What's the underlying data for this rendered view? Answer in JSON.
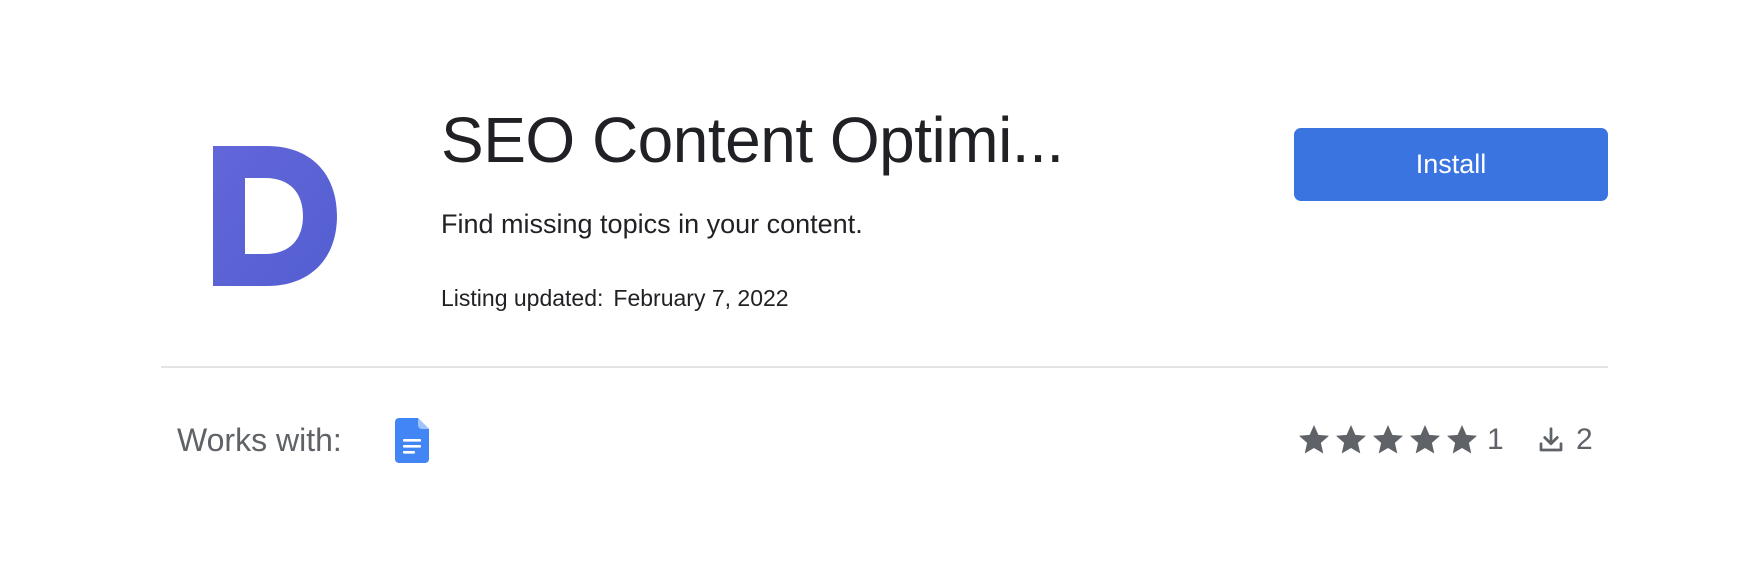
{
  "app": {
    "title": "SEO Content Optimi...",
    "subtitle": "Find missing topics in your content.",
    "listing_updated_label": "Listing updated:",
    "listing_updated_date": "February 7, 2022",
    "logo_letter": "D",
    "logo_color": "#5c64d6"
  },
  "actions": {
    "install_label": "Install",
    "install_color": "#3974e0"
  },
  "footer": {
    "works_with_label": "Works with:",
    "works_with_apps": [
      "google-docs-icon"
    ],
    "rating_stars": 5,
    "rating_count": "1",
    "downloads_count": "2"
  }
}
